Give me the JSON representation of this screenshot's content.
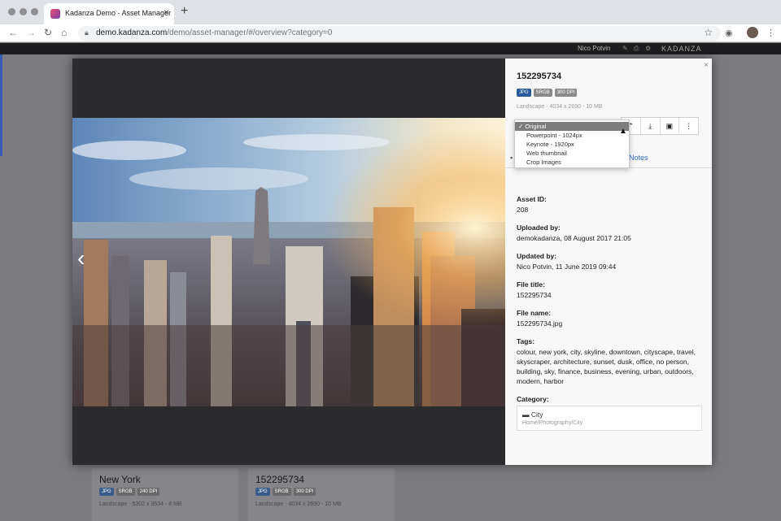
{
  "browser": {
    "tab_title": "Kadanza Demo - Asset Manager",
    "url_host": "demo.kadanza.com",
    "url_path": "/demo/asset-manager/#/overview?category=0"
  },
  "app_header": {
    "user_name": "Nico Potvin",
    "brand": "KADANZA"
  },
  "background_cards": [
    {
      "title": "New York",
      "badges": [
        "JPG",
        "SRGB",
        "240 DPI"
      ],
      "meta": "Landscape - 5302 x 3534 - 8 MB"
    },
    {
      "title": "152295734",
      "badges": [
        "JPG",
        "SRGB",
        "300 DPI"
      ],
      "meta": "Landscape - 4034 x 2690 - 10 MB"
    }
  ],
  "asset": {
    "title": "152295734",
    "badges": [
      "JPG",
      "SRGB",
      "300 DPI"
    ],
    "meta": "Landscape - 4034 x 2690 - 10 MB"
  },
  "download_menu": {
    "selected": "✓ Original",
    "options": [
      "Powerpoint - 1024px",
      "Keynote - 1920px",
      "Web thumbnail",
      "Crop Images"
    ]
  },
  "tabs": {
    "notes": "Notes"
  },
  "details": [
    {
      "label": "Asset ID:",
      "value": "208"
    },
    {
      "label": "Uploaded by:",
      "value": "demokadanza, 08 August 2017 21:05"
    },
    {
      "label": "Updated by:",
      "value": "Nico Potvin, 11 June 2019 09:44"
    },
    {
      "label": "File title:",
      "value": "152295734"
    },
    {
      "label": "File name:",
      "value": "152295734.jpg"
    },
    {
      "label": "Tags:",
      "value": "colour, new york, city, skyline, downtown, cityscape, travel, skyscraper, architecture, sunset, dusk, office, no person, building, sky, finance, business, evening, urban, outdoors, modern, harbor"
    }
  ],
  "category": {
    "label": "Category:",
    "name": "City",
    "path": "Home/Photography/City"
  },
  "icons": [
    "folder-icon",
    "download-icon",
    "briefcase-icon",
    "more-icon",
    "chevron-left-icon",
    "close-icon"
  ]
}
